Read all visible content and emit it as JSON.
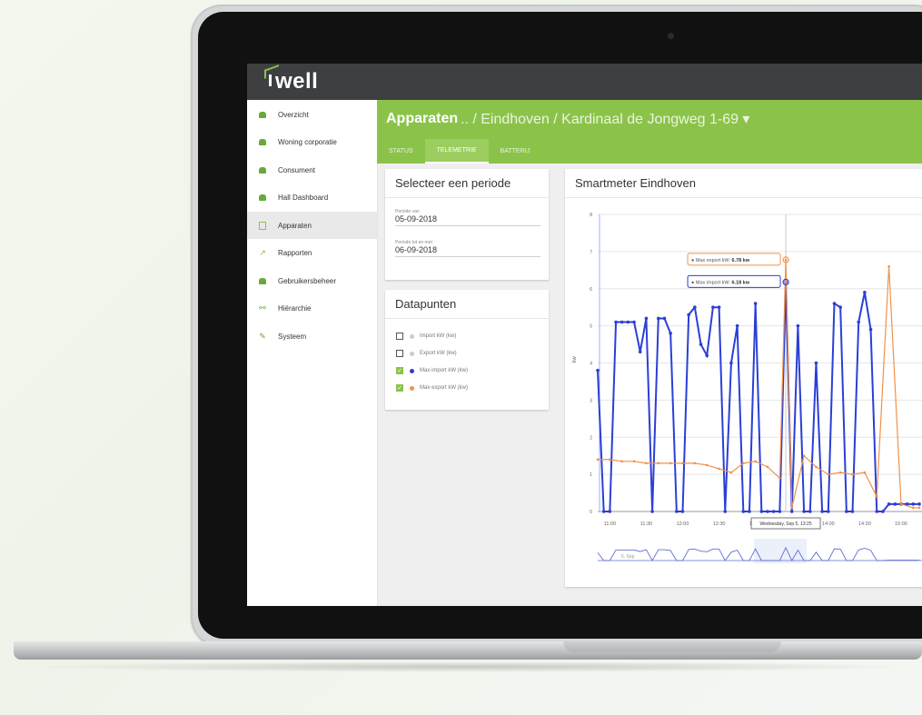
{
  "app": {
    "logo": "well"
  },
  "sidebar": {
    "items": [
      {
        "label": "Overzicht",
        "icon": "dashboard-icon"
      },
      {
        "label": "Woning corporatie",
        "icon": "housing-icon"
      },
      {
        "label": "Consument",
        "icon": "consumer-icon"
      },
      {
        "label": "Hall Dashboard",
        "icon": "dashboard-icon"
      },
      {
        "label": "Apparaten",
        "icon": "device-icon"
      },
      {
        "label": "Rapporten",
        "icon": "chart-icon"
      },
      {
        "label": "Gebruikersbeheer",
        "icon": "users-icon"
      },
      {
        "label": "Hiërarchie",
        "icon": "hierarchy-icon"
      },
      {
        "label": "Systeem",
        "icon": "wrench-icon"
      }
    ],
    "active_index": 4
  },
  "header": {
    "title": "Apparaten",
    "breadcrumb": ".. / Eindhoven / Kardinaal de Jongweg 1-69 ▾",
    "tabs": [
      "STATUS",
      "TELEMETRIE",
      "BATTERIJ"
    ],
    "active_tab": 1
  },
  "period": {
    "title": "Selecteer een periode",
    "from_label": "Periode van",
    "from_value": "05-09-2018",
    "to_label": "Periode tot en met",
    "to_value": "06-09-2018"
  },
  "datapoints": {
    "title": "Datapunten",
    "items": [
      {
        "label": "Import kW (kw)",
        "checked": false,
        "color": "#cccccc"
      },
      {
        "label": "Export kW (kw)",
        "checked": false,
        "color": "#cccccc"
      },
      {
        "label": "Max import kW (kw)",
        "checked": true,
        "color": "#2b3fd6"
      },
      {
        "label": "Max export kW (kw)",
        "checked": true,
        "color": "#f0924a"
      }
    ]
  },
  "chart_card": {
    "title": "Smartmeter Eindhoven"
  },
  "tooltips": {
    "export_prefix": "● Max export kW: ",
    "export_value": "6.78 kw",
    "import_prefix": "● Max import kW: ",
    "import_value": "6.18 kw",
    "crosshair_label": "Wednesday, Sep 5, 13:25"
  },
  "navigator": {
    "label": "5. Sep"
  },
  "chart_data": {
    "type": "line",
    "ylabel": "kw",
    "ylim": [
      0,
      8
    ],
    "yticks": [
      0,
      1,
      2,
      3,
      4,
      5,
      6,
      7,
      8
    ],
    "xticks": [
      "11:00",
      "11:30",
      "12:00",
      "12:30",
      "13:00",
      "13:30",
      "14:00",
      "14:30",
      "15:00"
    ],
    "xrange": [
      "10:50",
      "15:15"
    ],
    "grid": true,
    "series": [
      {
        "name": "Max import kW",
        "color": "#2b3fd6",
        "x": [
          "10:50",
          "10:55",
          "11:00",
          "11:05",
          "11:10",
          "11:15",
          "11:20",
          "11:25",
          "11:30",
          "11:35",
          "11:40",
          "11:45",
          "11:50",
          "11:55",
          "12:00",
          "12:05",
          "12:10",
          "12:15",
          "12:20",
          "12:25",
          "12:30",
          "12:35",
          "12:40",
          "12:45",
          "12:50",
          "12:55",
          "13:00",
          "13:05",
          "13:10",
          "13:15",
          "13:20",
          "13:25",
          "13:30",
          "13:35",
          "13:40",
          "13:45",
          "13:50",
          "13:55",
          "14:00",
          "14:05",
          "14:10",
          "14:15",
          "14:20",
          "14:25",
          "14:30",
          "14:35",
          "14:40",
          "14:45",
          "14:50",
          "14:55",
          "15:00",
          "15:05",
          "15:10",
          "15:15"
        ],
        "values": [
          3.8,
          0,
          0,
          5.1,
          5.1,
          5.1,
          5.1,
          4.3,
          5.2,
          0,
          5.2,
          5.2,
          4.8,
          0,
          0,
          5.3,
          5.5,
          4.5,
          4.2,
          5.5,
          5.5,
          0,
          4.0,
          5.0,
          0,
          0,
          5.6,
          0,
          0,
          0,
          0,
          6.18,
          0,
          5.0,
          0,
          0,
          4.0,
          0,
          0,
          5.6,
          5.5,
          0,
          0,
          5.1,
          5.9,
          4.9,
          0,
          0,
          0.2,
          0.2,
          0.2,
          0.2,
          0.2,
          0.2
        ]
      },
      {
        "name": "Max export kW",
        "color": "#f0924a",
        "x": [
          "10:50",
          "11:00",
          "11:10",
          "11:20",
          "11:30",
          "11:40",
          "11:50",
          "12:00",
          "12:10",
          "12:20",
          "12:30",
          "12:40",
          "12:50",
          "13:00",
          "13:10",
          "13:20",
          "13:25",
          "13:30",
          "13:40",
          "13:50",
          "14:00",
          "14:10",
          "14:20",
          "14:30",
          "14:40",
          "14:50",
          "15:00",
          "15:10",
          "15:15"
        ],
        "values": [
          1.4,
          1.4,
          1.35,
          1.35,
          1.3,
          1.3,
          1.3,
          1.3,
          1.3,
          1.25,
          1.15,
          1.05,
          1.3,
          1.35,
          1.2,
          0.9,
          6.78,
          0.1,
          1.5,
          1.2,
          1.0,
          1.05,
          1.0,
          1.05,
          0.4,
          6.6,
          0.2,
          0.1,
          0.1
        ]
      }
    ]
  }
}
